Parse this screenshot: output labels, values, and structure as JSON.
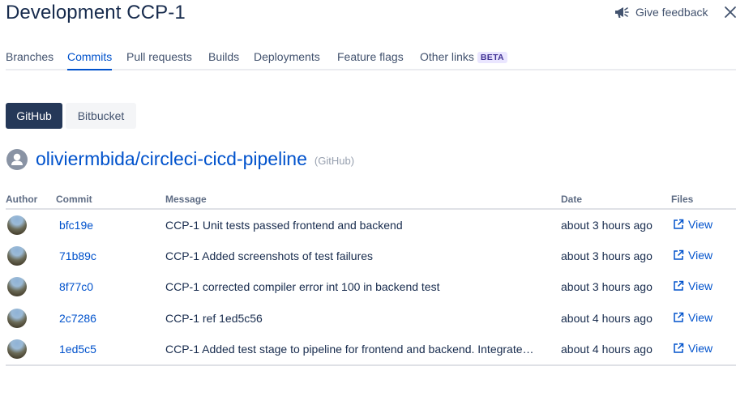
{
  "header": {
    "title": "Development CCP-1",
    "feedback_label": "Give feedback"
  },
  "tabs": [
    {
      "label": "Branches",
      "active": false
    },
    {
      "label": "Commits",
      "active": true
    },
    {
      "label": "Pull requests",
      "active": false
    },
    {
      "label": "Builds",
      "active": false
    },
    {
      "label": "Deployments",
      "active": false
    },
    {
      "label": "Feature flags",
      "active": false
    },
    {
      "label": "Other links",
      "badge": "BETA",
      "active": false
    }
  ],
  "providers": {
    "github": "GitHub",
    "bitbucket": "Bitbucket",
    "selected": "GitHub"
  },
  "repo": {
    "name": "oliviermbida/circleci-cicd-pipeline",
    "host": "(GitHub)"
  },
  "table": {
    "headers": {
      "author": "Author",
      "commit": "Commit",
      "message": "Message",
      "date": "Date",
      "files": "Files"
    },
    "rows": [
      {
        "commit": "bfc19e",
        "message": "CCP-1 Unit tests passed frontend and backend",
        "date": "about 3 hours ago",
        "files": "View"
      },
      {
        "commit": "71b89c",
        "message": "CCP-1 Added screenshots of test failures",
        "date": "about 3 hours ago",
        "files": "View"
      },
      {
        "commit": "8f77c0",
        "message": "CCP-1 corrected compiler error int 100 in backend test",
        "date": "about 3 hours ago",
        "files": "View"
      },
      {
        "commit": "2c7286",
        "message": "CCP-1 ref 1ed5c56",
        "date": "about 4 hours ago",
        "files": "View"
      },
      {
        "commit": "1ed5c5",
        "message": "CCP-1 Added test stage to pipeline for frontend and backend. Integrate…",
        "date": "about 4 hours ago",
        "files": "View"
      }
    ]
  },
  "colors": {
    "link": "#0052cc",
    "text": "#172b4d",
    "selected_segment": "#253858",
    "beta_badge_bg": "#eae6ff",
    "beta_badge_text": "#403294"
  },
  "icons": {
    "feedback": "megaphone-icon",
    "close": "close-icon",
    "repo": "user-avatar-icon",
    "view": "external-link-icon"
  }
}
